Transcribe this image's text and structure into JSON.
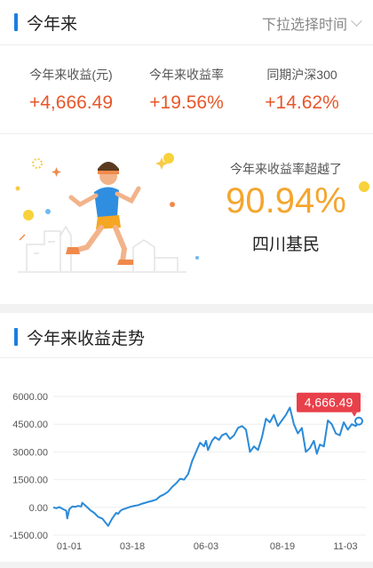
{
  "ytd_section": {
    "title": "今年来",
    "time_picker_label": "下拉选择时间",
    "stats": [
      {
        "label": "今年来收益(元)",
        "value": "+4,666.49"
      },
      {
        "label": "今年来收益率",
        "value": "+19.56%"
      },
      {
        "label": "同期沪深300",
        "value": "+14.62%"
      }
    ],
    "beat": {
      "label": "今年来收益率超越了",
      "value": "90.94%",
      "region": "四川基民"
    }
  },
  "trend_section": {
    "title": "今年来收益走势"
  },
  "colors": {
    "accent_blue": "#1a7fe0",
    "positive_red": "#e8562a",
    "beat_orange": "#f4a62e",
    "tag_red": "#e8404a",
    "line_blue": "#2a8ad8"
  },
  "chart_data": {
    "type": "line",
    "x_tick_labels": [
      "01-01",
      "03-18",
      "06-03",
      "08-19",
      "11-03"
    ],
    "y_tick_labels": [
      "6000.00",
      "4500.00",
      "3000.00",
      "1500.00",
      "0.00",
      "-1500.00"
    ],
    "ylim": [
      -1500,
      6000
    ],
    "end_label": "4,666.49",
    "grid": "horizontal",
    "x": [
      1,
      4,
      7,
      11,
      14,
      15,
      17,
      20,
      23,
      26,
      29,
      30,
      34,
      38,
      42,
      46,
      50,
      56,
      60,
      64,
      66,
      68,
      70,
      74,
      78,
      82,
      86,
      90,
      94,
      96,
      100,
      104,
      108,
      112,
      116,
      120,
      124,
      128,
      132,
      136,
      140,
      144,
      148,
      152,
      154,
      156,
      160,
      163,
      167,
      170,
      174,
      178,
      182,
      186,
      190,
      194,
      198,
      202,
      206,
      210,
      214,
      218,
      222,
      226,
      230,
      234,
      238,
      242,
      246,
      250,
      254,
      258,
      262,
      265,
      268,
      272,
      276,
      280,
      284,
      288,
      292,
      296,
      300,
      304,
      307
    ],
    "series": [
      {
        "values": [
          0,
          -50,
          20,
          -100,
          -180,
          -600,
          -100,
          50,
          30,
          80,
          50,
          250,
          60,
          -150,
          -300,
          -520,
          -600,
          -1000,
          -600,
          -300,
          -350,
          -200,
          -120,
          -50,
          30,
          80,
          120,
          200,
          260,
          300,
          350,
          420,
          600,
          700,
          850,
          1100,
          1300,
          1550,
          1500,
          1800,
          2500,
          3000,
          3500,
          3300,
          3600,
          3100,
          3600,
          3800,
          3650,
          3900,
          4000,
          3700,
          3900,
          4300,
          4400,
          4200,
          3000,
          3300,
          3100,
          3800,
          4800,
          4600,
          5000,
          4400,
          4700,
          5000,
          5400,
          4500,
          4000,
          4300,
          3000,
          3200,
          3600,
          2900,
          3400,
          3300,
          4700,
          4500,
          4000,
          3900,
          4600,
          4200,
          4500,
          4400,
          4666.49
        ]
      }
    ]
  }
}
